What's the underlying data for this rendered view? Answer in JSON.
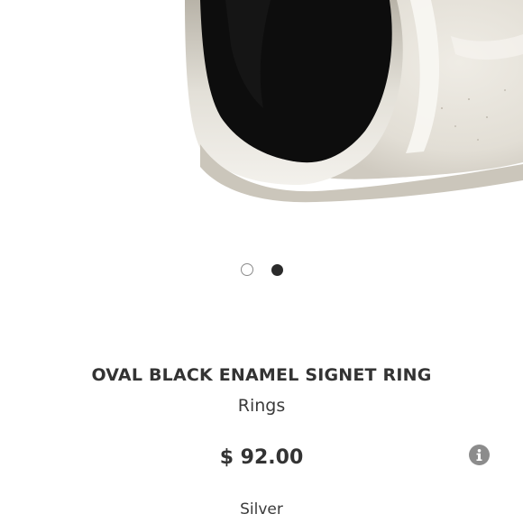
{
  "product": {
    "title": "OVAL BLACK ENAMEL SIGNET RING",
    "category": "Rings",
    "price": "$ 92.00",
    "color": "Silver"
  },
  "carousel": {
    "total_images": 2,
    "active_index": 2
  },
  "icons": {
    "info": "info-icon"
  },
  "colors": {
    "text": "#333333",
    "active_dot": "#2b2b2b",
    "inactive_dot_border": "#8a8a8a",
    "info_button": "#8c8c8c",
    "enamel": "#0d0d0d",
    "silver": "#d9d6cf"
  }
}
